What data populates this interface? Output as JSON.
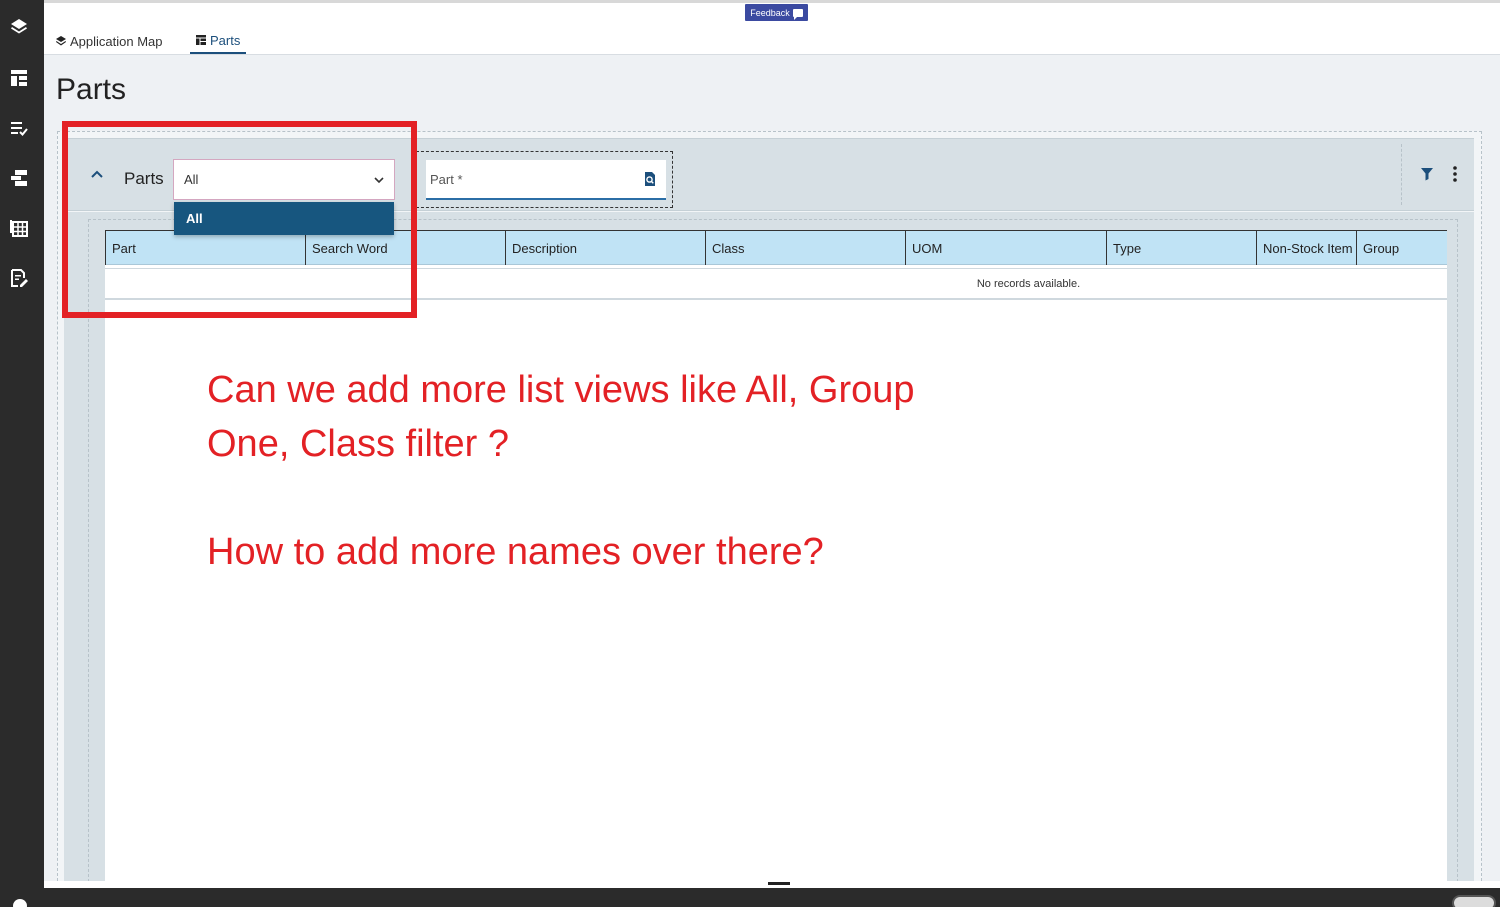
{
  "feedback_label": "Feedback",
  "tabs": [
    {
      "label": "Application Map",
      "active": false
    },
    {
      "label": "Parts",
      "active": true
    }
  ],
  "page_title": "Parts",
  "panel": {
    "label": "Parts",
    "list_view": {
      "selected": "All",
      "options": [
        "All"
      ]
    },
    "search": {
      "placeholder": "Part *"
    }
  },
  "table": {
    "columns": [
      "Part",
      "Search Word",
      "Description",
      "Class",
      "UOM",
      "Type",
      "Non-Stock Item",
      "Group"
    ],
    "empty_message": "No records available."
  },
  "annotation": {
    "line1": "Can we add more list views like All, Group",
    "line2": "One, Class filter ?",
    "line3": "",
    "line4": "How to add more names over there?"
  },
  "colors": {
    "annotation": "#e32125",
    "accent": "#17567f",
    "header_bg": "#c0e3f5",
    "rail_bg": "#2b2b2b"
  }
}
